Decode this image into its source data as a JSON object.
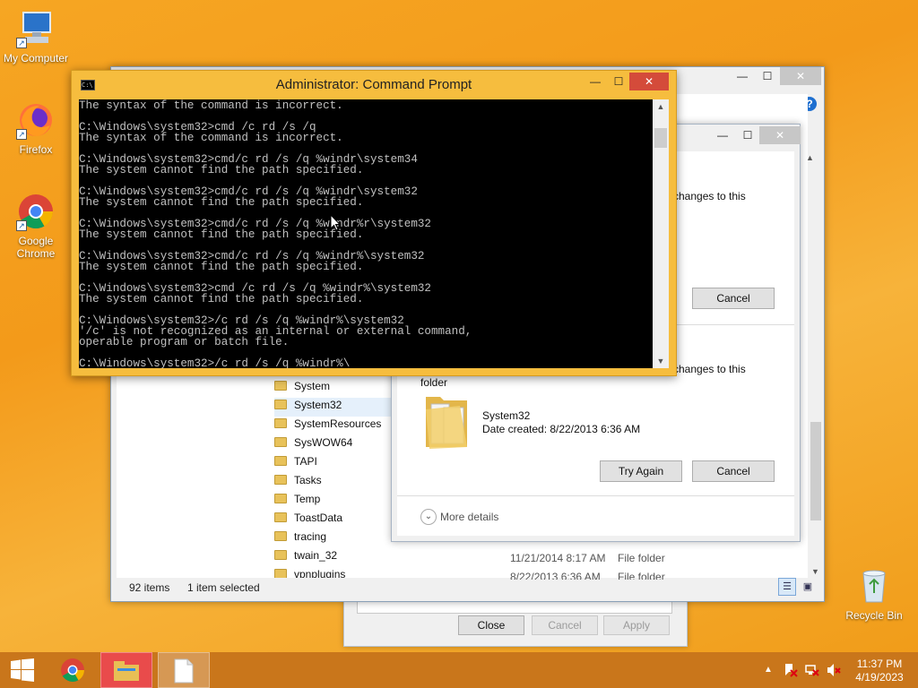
{
  "desktop": {
    "icons": [
      {
        "label": "My Computer",
        "icon": "computer-icon"
      },
      {
        "label": "Firefox",
        "icon": "firefox-icon"
      },
      {
        "label": "Google Chrome",
        "icon": "chrome-icon"
      },
      {
        "label": "Recycle Bin",
        "icon": "recycle-bin-icon"
      }
    ]
  },
  "cmd": {
    "title": "Administrator:  Command Prompt",
    "icon_text": "C:\\",
    "lines": [
      "The syntax of the command is incorrect.",
      "",
      "C:\\Windows\\system32>cmd /c rd /s /q",
      "The syntax of the command is incorrect.",
      "",
      "C:\\Windows\\system32>cmd/c rd /s /q %windr\\system34",
      "The system cannot find the path specified.",
      "",
      "C:\\Windows\\system32>cmd/c rd /s /q %windr\\system32",
      "The system cannot find the path specified.",
      "",
      "C:\\Windows\\system32>cmd/c rd /s /q %windr%r\\system32",
      "The system cannot find the path specified.",
      "",
      "C:\\Windows\\system32>cmd/c rd /s /q %windr%\\system32",
      "The system cannot find the path specified.",
      "",
      "C:\\Windows\\system32>cmd /c rd /s /q %windr%\\system32",
      "The system cannot find the path specified.",
      "",
      "C:\\Windows\\system32>/c rd /s /q %windr%\\system32",
      "'/c' is not recognized as an internal or external command,",
      "operable program or batch file.",
      "",
      "C:\\Windows\\system32>/c rd /s /q %windr%\\"
    ]
  },
  "explorer": {
    "folders": [
      "System",
      "System32",
      "SystemResources",
      "SysWOW64",
      "TAPI",
      "Tasks",
      "Temp",
      "ToastData",
      "tracing",
      "twain_32",
      "vpnplugins"
    ],
    "selected": "System32",
    "rows_detail": [
      {
        "date": "11/21/2014 8:17 AM",
        "type": "File folder"
      },
      {
        "date": "8/22/2013 6:36 AM",
        "type": "File folder"
      }
    ],
    "status_items": "92 items",
    "status_selected": "1 item selected",
    "help_icon": "?"
  },
  "dialog": {
    "text_changes_top": "changes to this",
    "cancel_top": "Cancel",
    "text_changes": "changes to this",
    "text_folder": "folder",
    "item_name": "System32",
    "item_date": "Date created: 8/22/2013 6:36 AM",
    "try_again": "Try Again",
    "cancel": "Cancel",
    "more_details": "More details"
  },
  "props": {
    "close": "Close",
    "cancel": "Cancel",
    "apply": "Apply"
  },
  "tray": {
    "time": "11:37 PM",
    "date": "4/19/2023"
  },
  "colors": {
    "accent": "#f6bd3e",
    "close_red": "#d44b3a",
    "taskbar": "#c9761b"
  }
}
